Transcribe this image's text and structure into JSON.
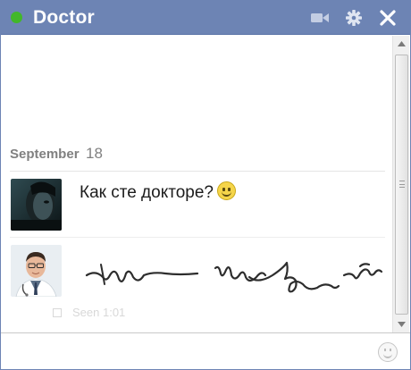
{
  "chat": {
    "title": "Doctor",
    "status_color": "#42b72a",
    "header_color": "#6d84b4",
    "header_icons": [
      "video-camera-icon",
      "gear-icon",
      "close-icon"
    ]
  },
  "conversation": {
    "date_label": "September",
    "date_day": "18",
    "messages": [
      {
        "text": "Как сте докторе?",
        "emoji": "smiley-icon",
        "avatar": "dark-portrait"
      },
      {
        "text": "",
        "content": "handwritten-scribble",
        "avatar": "doctor-portrait"
      }
    ],
    "seen_label": "Seen 1:01"
  },
  "composer": {
    "placeholder": "",
    "emoji_icon": "smiley-icon"
  }
}
